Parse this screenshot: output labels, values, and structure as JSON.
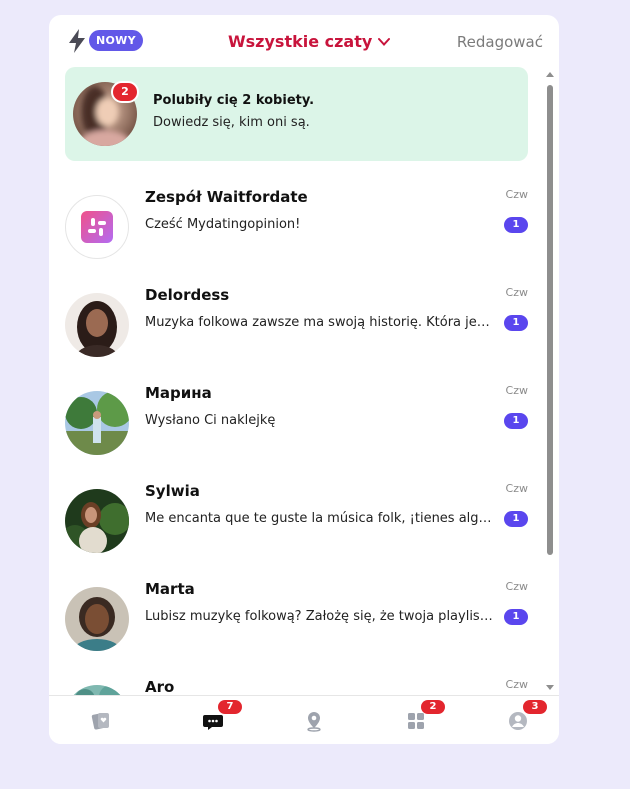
{
  "header": {
    "new_label": "NOWY",
    "title": "Wszystkie czaty",
    "edit_label": "Redagować"
  },
  "promo": {
    "count": "2",
    "title": "Polubiły cię 2 kobiety.",
    "subtitle": "Dowiedz się, kim oni są."
  },
  "chats": [
    {
      "name": "Zespół Waitfordate",
      "preview": "Cześć Mydatingopinion!",
      "time": "Czw",
      "unread": "1",
      "icon": "app-logo-icon"
    },
    {
      "name": "Delordess",
      "preview": "Muzyka folkowa zawsze ma swoją historię. Która jest twoja ulubiona?",
      "time": "Czw",
      "unread": "1"
    },
    {
      "name": "Марина",
      "preview": "Wysłano Ci naklejkę",
      "time": "Czw",
      "unread": "1"
    },
    {
      "name": "Sylwia",
      "preview": "Me encanta que te guste la música folk, ¡tienes alguna favorita?",
      "time": "Czw",
      "unread": "1"
    },
    {
      "name": "Marta",
      "preview": "Lubisz muzykę folkową? Założę się, że twoja playlista jest świetna",
      "time": "Czw",
      "unread": "1"
    },
    {
      "name": "Aro",
      "preview": "",
      "time": "Czw",
      "unread": ""
    }
  ],
  "tabs": [
    {
      "name": "cards",
      "icon": "cards-icon",
      "badge": ""
    },
    {
      "name": "chats",
      "icon": "chat-icon",
      "badge": "7"
    },
    {
      "name": "nearby",
      "icon": "map-pin-icon",
      "badge": ""
    },
    {
      "name": "apps",
      "icon": "grid-icon",
      "badge": "2"
    },
    {
      "name": "profile",
      "icon": "profile-icon",
      "badge": "3"
    }
  ],
  "colors": {
    "accent": "#c8143c",
    "badge_purple": "#5a46ee",
    "badge_red": "#e3262e",
    "promo_bg": "#dcf5e8",
    "page_bg": "#eceafb"
  }
}
